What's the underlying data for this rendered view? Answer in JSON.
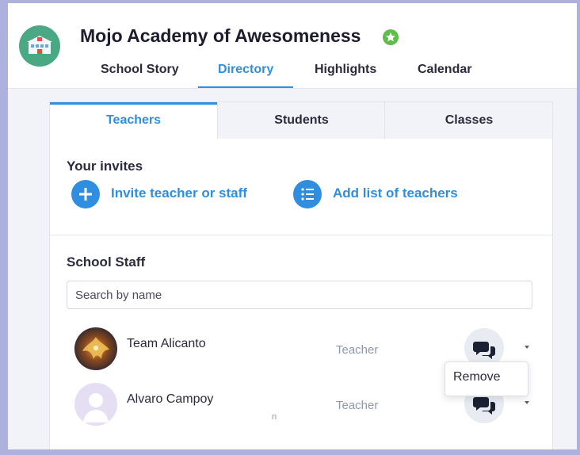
{
  "school": {
    "name": "Mojo Academy of Awesomeness",
    "avatar_icon": "school-building-icon",
    "verified_icon": "verified-badge-icon"
  },
  "nav": {
    "tabs": [
      "School Story",
      "Directory",
      "Highlights",
      "Calendar"
    ],
    "active": "Directory"
  },
  "directory": {
    "tabs": [
      "Teachers",
      "Students",
      "Classes"
    ],
    "active_tab": "Teachers",
    "invites": {
      "heading": "Your invites",
      "invite_label": "Invite teacher or staff",
      "add_list_label": "Add list of teachers"
    },
    "staff": {
      "heading": "School Staff",
      "search_placeholder": "Search by name",
      "members": [
        {
          "name": "Team Alicanto",
          "role": "Teacher"
        },
        {
          "name": "Alvaro Campoy",
          "role": "Teacher"
        }
      ],
      "stray_char": "n"
    },
    "menu": {
      "remove_label": "Remove"
    }
  },
  "colors": {
    "accent": "#2f8ee0",
    "school_avatar": "#4aa885",
    "verified": "#5fbd4a",
    "frame": "#aeb0dd"
  }
}
